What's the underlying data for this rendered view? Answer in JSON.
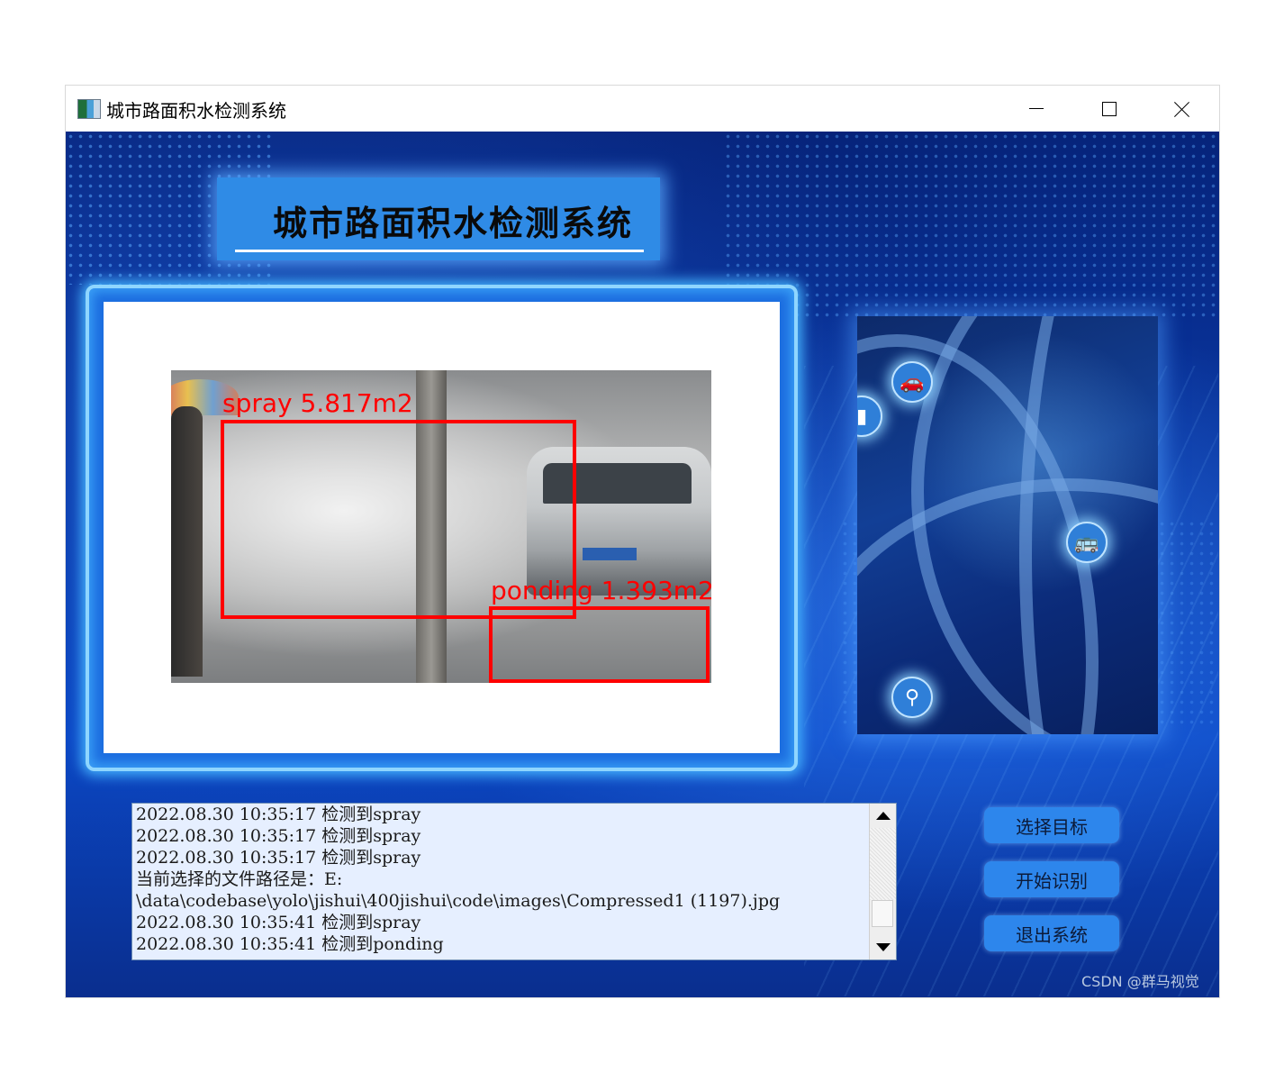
{
  "window": {
    "title": "城市路面积水检测系统",
    "app_icon": "app-window-icon",
    "controls": [
      "minimize-icon",
      "maximize-icon",
      "close-icon"
    ]
  },
  "header": {
    "title": "城市路面积水检测系统"
  },
  "detection": {
    "boxes": [
      {
        "label": "spray 5.817m2",
        "color": "#ff0000"
      },
      {
        "label": "ponding 1.393m2",
        "color": "#ff0000"
      }
    ]
  },
  "city_panel": {
    "icons": [
      "car-icon",
      "bus-icon",
      "search-icon",
      "truck-icon"
    ]
  },
  "log": {
    "lines": [
      "2022.08.30 10:35:17 检测到spray",
      "2022.08.30 10:35:17 检测到spray",
      "2022.08.30 10:35:17 检测到spray",
      "当前选择的文件路径是：E:",
      "\\data\\codebase\\yolo\\jishui\\400jishui\\code\\images\\Compressed1 (1197).jpg",
      "2022.08.30 10:35:41 检测到spray",
      "2022.08.30 10:35:41 检测到ponding"
    ]
  },
  "buttons": {
    "select_target": "选择目标",
    "start_recognition": "开始识别",
    "exit_system": "退出系统"
  },
  "footer": {
    "watermark": "CSDN @群马视觉"
  },
  "colors": {
    "accent": "#2d86ec",
    "bbox": "#ff0000",
    "frame_glow": "#8fd6ff"
  }
}
